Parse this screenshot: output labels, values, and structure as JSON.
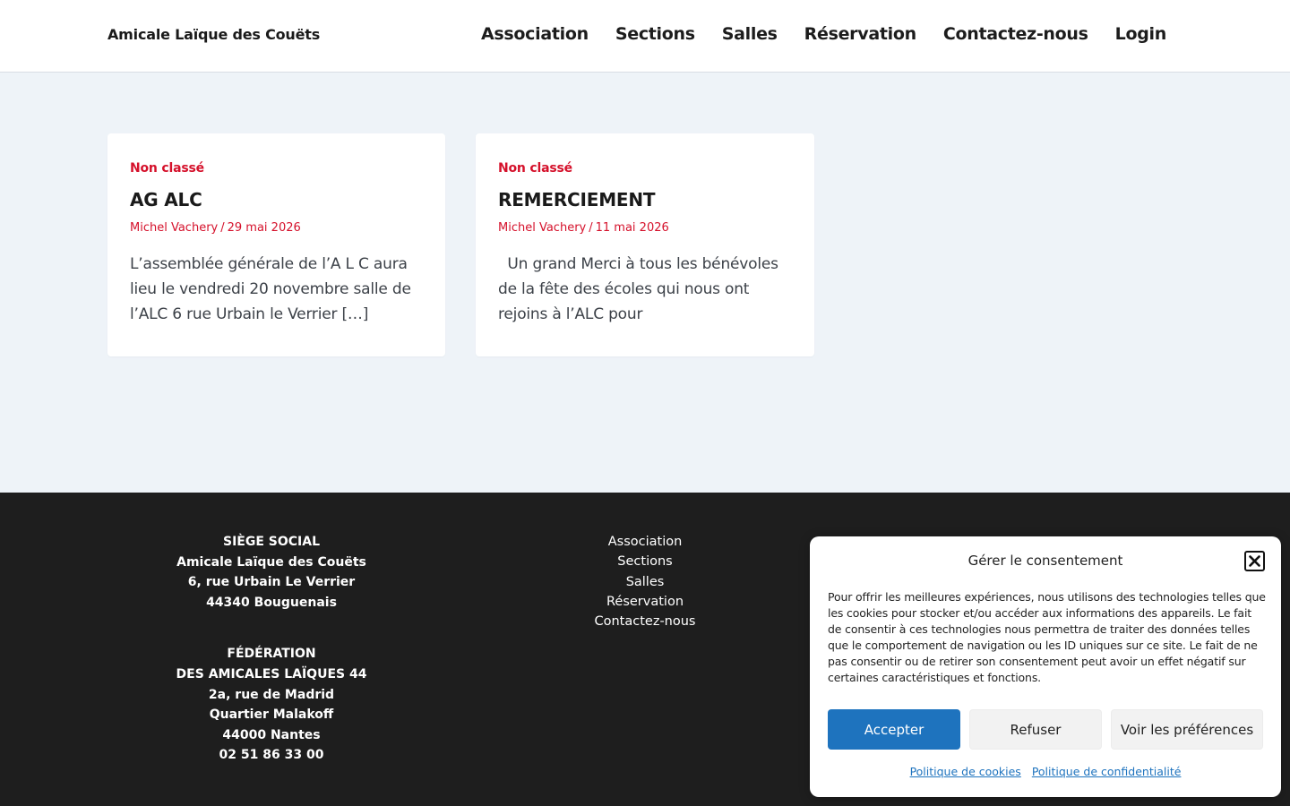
{
  "header": {
    "site_title": "Amicale Laïque des Couëts",
    "nav": [
      "Association",
      "Sections",
      "Salles",
      "Réservation",
      "Contactez-nous",
      "Login"
    ]
  },
  "posts": [
    {
      "category": "Non classé",
      "title": "AG ALC",
      "author": "Michel Vachery",
      "separator": "/",
      "date": "29 mai 2026",
      "excerpt": "L’assemblée générale de  l’A L C aura lieu le vendredi 20 novembre salle de l’ALC 6 rue Urbain le Verrier […]"
    },
    {
      "category": "Non classé",
      "title": "REMERCIEMENT",
      "author": "Michel Vachery",
      "separator": "/",
      "date": "11 mai 2026",
      "excerpt": "  Un grand Merci à tous les bénévoles de la fête des écoles qui nous ont rejoins à l’ALC pour"
    }
  ],
  "footer": {
    "siege": [
      "SIÈGE SOCIAL",
      "Amicale Laïque des Couëts",
      "6, rue Urbain Le Verrier",
      "44340 Bouguenais"
    ],
    "federation": [
      "FÉDÉRATION",
      "DES AMICALES LAÏQUES 44",
      "2a, rue de Madrid",
      "Quartier Malakoff",
      "44000 Nantes",
      "02 51 86 33 00"
    ],
    "menu": [
      "Association",
      "Sections",
      "Salles",
      "Réservation",
      "Contactez-nous"
    ]
  },
  "consent": {
    "title": "Gérer le consentement",
    "text": "Pour offrir les meilleures expériences, nous utilisons des technologies telles que les cookies pour stocker et/ou accéder aux informations des appareils. Le fait de consentir à ces technologies nous permettra de traiter des données telles que le comportement de navigation ou les ID uniques sur ce site. Le fait de ne pas consentir ou de retirer son consentement peut avoir un effet négatif sur certaines caractéristiques et fonctions.",
    "accept": "Accepter",
    "refuse": "Refuser",
    "preferences": "Voir les préférences",
    "cookie_policy": "Politique de cookies",
    "privacy_policy": "Politique de confidentialité",
    "accent_color": "#1e73be",
    "close_icon": "close-icon"
  },
  "colors": {
    "accent_red": "#d5112b",
    "footer_bg": "#1e1e1e",
    "page_bg": "#eef3f8"
  }
}
